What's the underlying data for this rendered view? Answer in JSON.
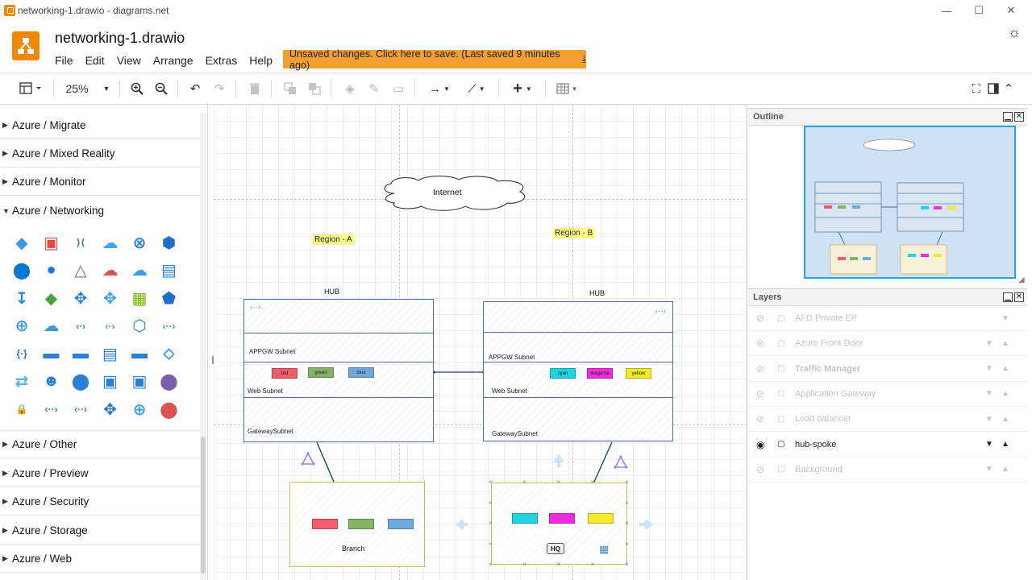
{
  "window": {
    "title": "networking-1.drawio - diagrams.net",
    "minimize": "—",
    "maximize": "☐",
    "close": "✕"
  },
  "header": {
    "doc_title": "networking-1.drawio",
    "menu": [
      "File",
      "Edit",
      "View",
      "Arrange",
      "Extras",
      "Help"
    ],
    "save_banner": "Unsaved changes. Click here to save. (Last saved 9 minutes ago)",
    "theme_icon": "sun-icon"
  },
  "toolbar": {
    "zoom": "25%"
  },
  "sidebar": {
    "categories_top": [
      "Azure / Migrate",
      "Azure / Mixed Reality",
      "Azure / Monitor"
    ],
    "open_category": "Azure / Networking",
    "categories_bottom": [
      "Azure / Other",
      "Azure / Preview",
      "Azure / Security",
      "Azure / Storage",
      "Azure / Web"
    ]
  },
  "diagram": {
    "internet": "Internet",
    "region_a": "Region - A",
    "region_b": "Region - B",
    "hub_a": {
      "title": "HUB",
      "subnets": [
        "APPGW Subnet",
        "Web Subnet",
        "GatewaySubnet"
      ],
      "chips": [
        {
          "label": "red",
          "color": "#f25c6b"
        },
        {
          "label": "green",
          "color": "#82b366"
        },
        {
          "label": "blue",
          "color": "#6fa8dc"
        }
      ]
    },
    "hub_b": {
      "title": "HUB",
      "subnets": [
        "APPGW Subnet",
        "Web Subnet",
        "GatewaySubnet"
      ],
      "chips": [
        {
          "label": "cyan",
          "color": "#22d3e6"
        },
        {
          "label": "magenta",
          "color": "#ee2de0"
        },
        {
          "label": "yellow",
          "color": "#f2ea2a"
        }
      ]
    },
    "branch": {
      "label": "Branch",
      "chips": [
        "#f25c6b",
        "#82b366",
        "#6fa8dc"
      ]
    },
    "hq": {
      "label": "HQ",
      "chips": [
        "#22d3e6",
        "#ee2de0",
        "#f2ea2a"
      ]
    }
  },
  "outline": {
    "title": "Outline"
  },
  "layers": {
    "title": "Layers",
    "items": [
      {
        "name": "AFD Private EP",
        "active": false
      },
      {
        "name": "Azure Front Door",
        "active": false
      },
      {
        "name": "Traffic Manager",
        "active": false
      },
      {
        "name": "Application Gateway",
        "active": false
      },
      {
        "name": "Load balancer",
        "active": false
      },
      {
        "name": "hub-spoke",
        "active": true
      },
      {
        "name": "Background",
        "active": false
      }
    ]
  }
}
